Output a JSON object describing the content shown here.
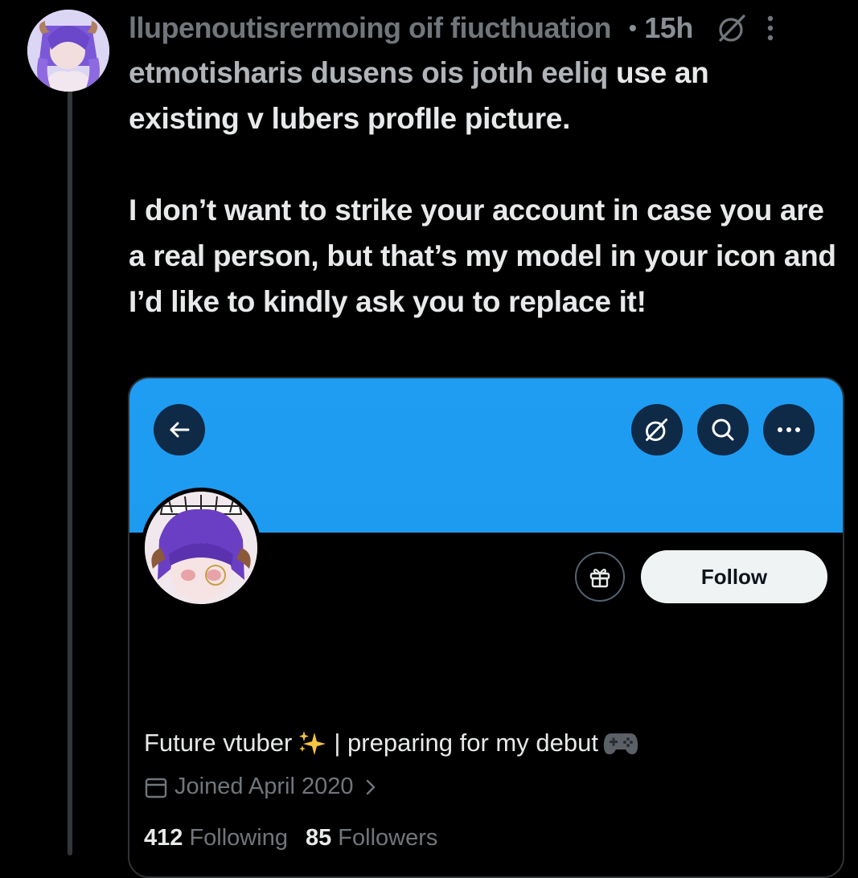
{
  "post": {
    "author_name": "llupenoutisrermoing oif fiucthuation",
    "separator": "•",
    "timestamp": "15h",
    "text_line1_ghost": "etmotisharis dusens ois jotıh eeliq",
    "text_line1_rest": " use an",
    "text_line2": "existing v lubers profIle picture.",
    "text_para2": "I don’t want to strike your account in case you are a real person, but that’s my model in your icon and I’d like to kindly ask you to replace it!"
  },
  "embedded_profile": {
    "follow_label": "Follow",
    "bio_part1": "Future vtuber",
    "bio_part2": "| preparing for my debut",
    "joined": "Joined April 2020",
    "following_count": "412",
    "following_label": "Following",
    "followers_count": "85",
    "followers_label": "Followers",
    "banner_color": "#1d9bf0"
  },
  "icons": {
    "back": "arrow-left-icon",
    "grok": "grok-icon",
    "search": "search-icon",
    "more": "more-horizontal-icon",
    "gift": "gift-icon",
    "calendar": "calendar-icon",
    "sparkles": "sparkles-emoji",
    "gamepad": "game-controller-emoji"
  }
}
